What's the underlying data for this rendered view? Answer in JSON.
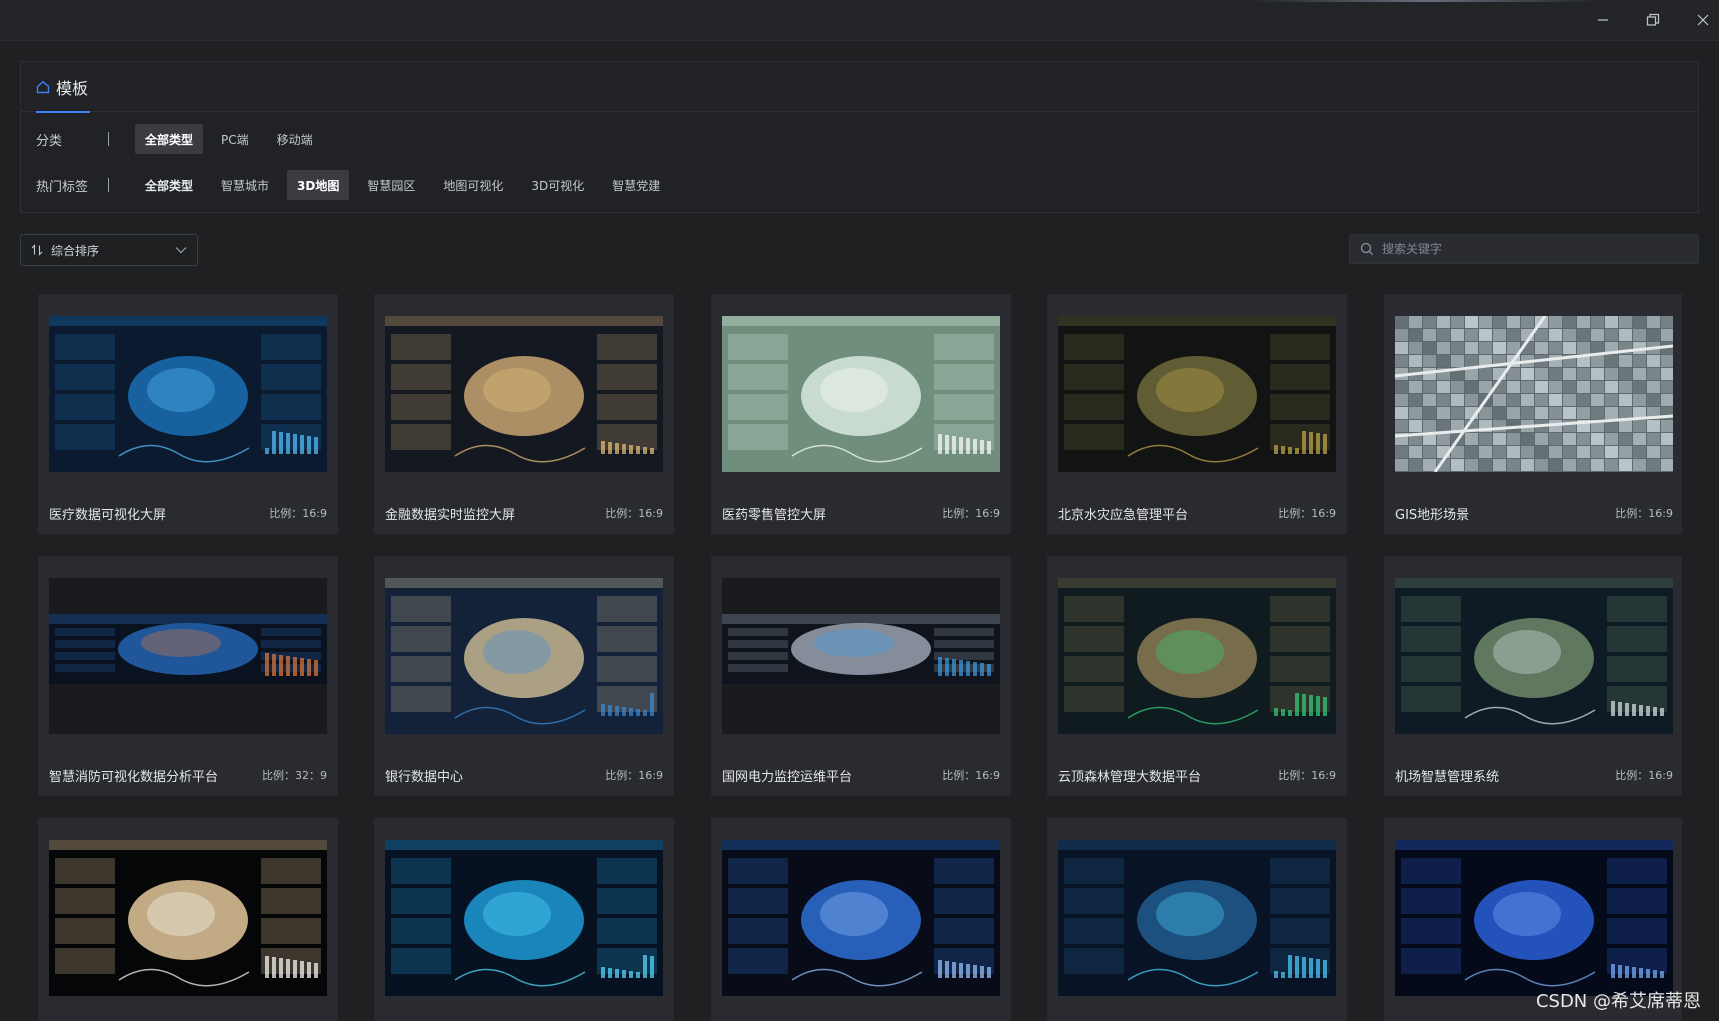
{
  "panel": {
    "tab_label": "模板",
    "category": {
      "label": "分类",
      "chips": [
        "全部类型",
        "PC端",
        "移动端"
      ],
      "active_index": 0
    },
    "hot_tags": {
      "label": "热门标签",
      "chips": [
        "全部类型",
        "智慧城市",
        "3D地图",
        "智慧园区",
        "地图可视化",
        "3D可视化",
        "智慧党建"
      ],
      "active_index": 2
    }
  },
  "toolbar": {
    "sort_label": "综合排序",
    "search_placeholder": "搜索关键字"
  },
  "cards": [
    {
      "name": "医疗数据可视化大屏",
      "ratio": "比例：16:9",
      "palette": [
        "#0b1a2e",
        "#1b6fb3",
        "#58c3ff"
      ]
    },
    {
      "name": "金融数据实时监控大屏",
      "ratio": "比例：16:9",
      "palette": [
        "#141820",
        "#c7a572",
        "#e9c27a"
      ]
    },
    {
      "name": "医药零售管控大屏",
      "ratio": "比例：16:9",
      "palette": [
        "#6f8f7c",
        "#d9e8df",
        "#ffffff"
      ]
    },
    {
      "name": "北京水灾应急管理平台",
      "ratio": "比例：16:9",
      "palette": [
        "#121414",
        "#6f6a3a",
        "#c8a94a"
      ]
    },
    {
      "name": "GIS地形场景",
      "ratio": "比例：16:9",
      "palette": [
        "#5d6a6f",
        "#a8b2b3",
        "#d6dcdc"
      ]
    },
    {
      "name": "智慧消防可视化数据分析平台",
      "ratio": "比例：32：9",
      "palette": [
        "#0a1220",
        "#2563b0",
        "#e07a3a"
      ]
    },
    {
      "name": "银行数据中心",
      "ratio": "比例：16:9",
      "palette": [
        "#132238",
        "#c7b690",
        "#3d8bd9"
      ]
    },
    {
      "name": "国网电力监控运维平台",
      "ratio": "比例：16:9",
      "palette": [
        "#0e131c",
        "#9aa3b1",
        "#3aa0e6"
      ]
    },
    {
      "name": "云顶森林管理大数据平台",
      "ratio": "比例：16:9",
      "palette": [
        "#0f1b1e",
        "#8a7a55",
        "#35d07a"
      ]
    },
    {
      "name": "机场智慧管理系统",
      "ratio": "比例：16:9",
      "palette": [
        "#0e1a24",
        "#6d8a6a",
        "#dfe6ea"
      ]
    },
    {
      "name": "",
      "ratio": "",
      "palette": [
        "#050608",
        "#e3c89a",
        "#ffffff"
      ]
    },
    {
      "name": "",
      "ratio": "",
      "palette": [
        "#061222",
        "#1f9ad6",
        "#5be0ff"
      ]
    },
    {
      "name": "",
      "ratio": "",
      "palette": [
        "#070c18",
        "#2d6fd6",
        "#9cc7ff"
      ]
    },
    {
      "name": "",
      "ratio": "",
      "palette": [
        "#081426",
        "#1f5a8f",
        "#4fd2ff"
      ]
    },
    {
      "name": "",
      "ratio": "",
      "palette": [
        "#050a1a",
        "#2a5fd8",
        "#7fb3ff"
      ]
    }
  ],
  "watermark": "CSDN @希艾席蒂恩",
  "colors": {
    "accent": "#3b82f6",
    "background": "#1f2022",
    "card": "#292b30"
  }
}
